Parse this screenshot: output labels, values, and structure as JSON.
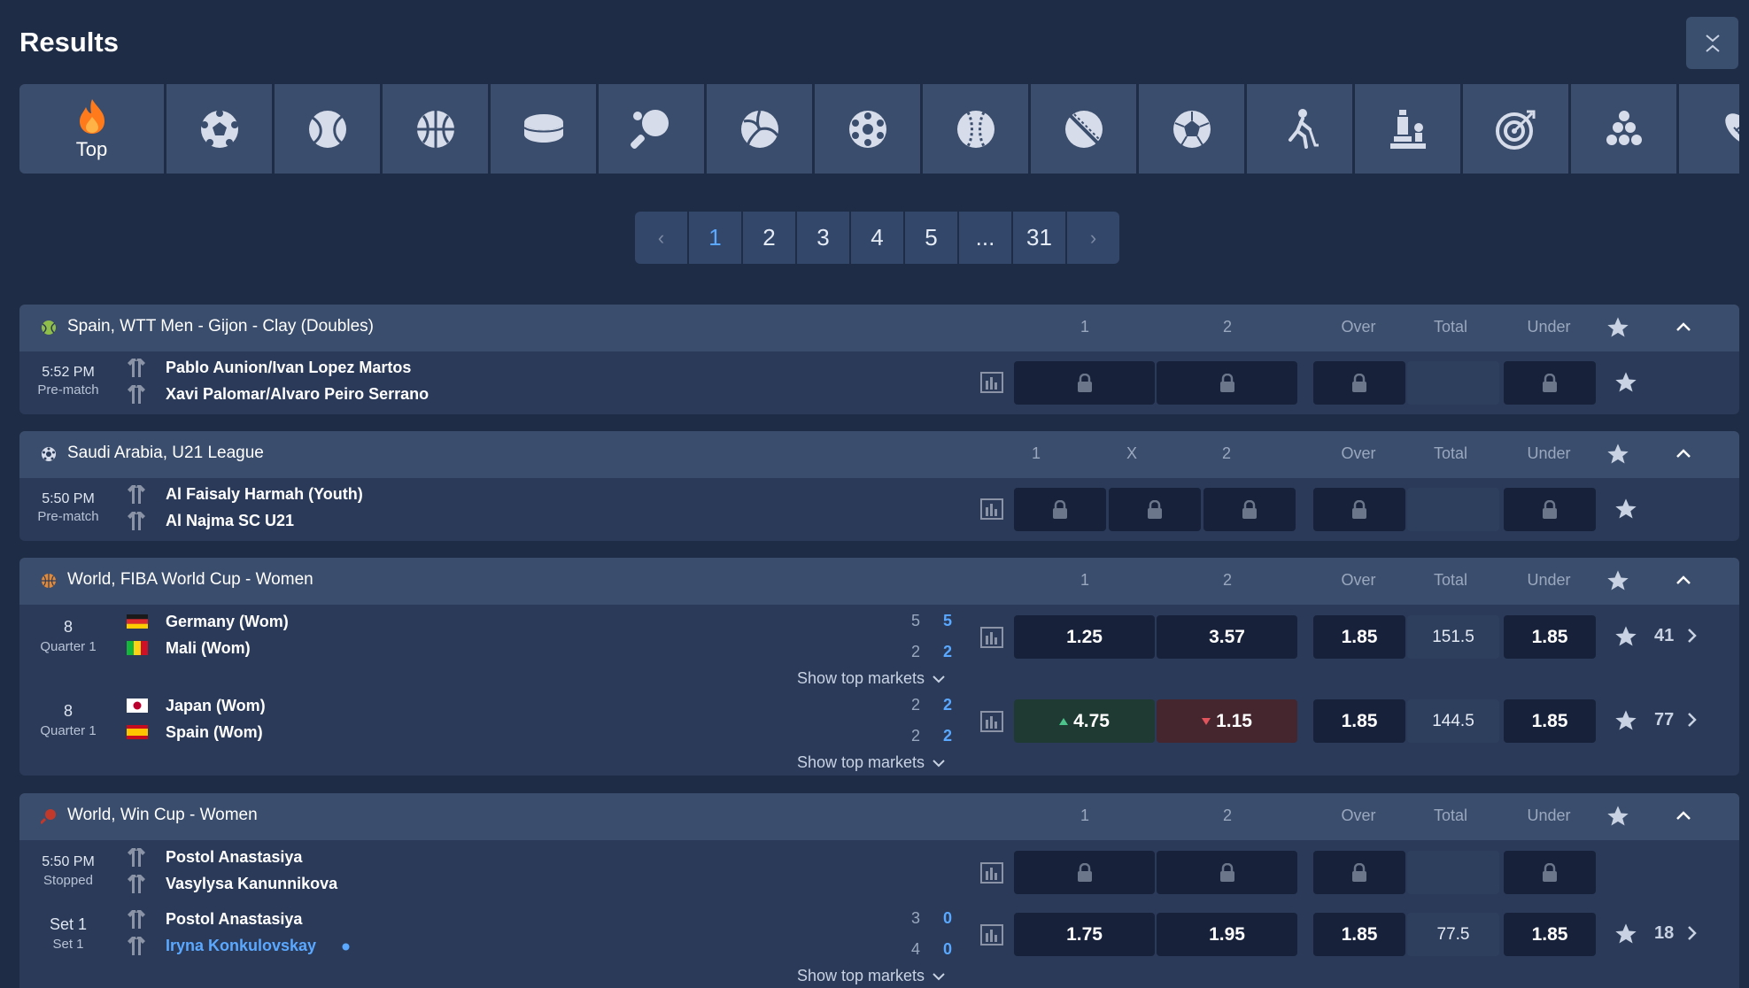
{
  "title": "Results",
  "sports_tabs": {
    "top_label": "Top",
    "icons": [
      "fire-icon",
      "soccer-ball-icon",
      "tennis-ball-icon",
      "basketball-icon",
      "ice-hockey-puck-icon",
      "table-tennis-icon",
      "volleyball-icon",
      "futsal-ball-icon",
      "baseball-icon",
      "cricket-ball-icon",
      "soccer-icon-2",
      "field-hockey-icon",
      "chess-icon",
      "darts-icon",
      "pool-balls-icon",
      "american-football-icon"
    ]
  },
  "pagination": {
    "pages": [
      "1",
      "2",
      "3",
      "4",
      "5",
      "...",
      "31"
    ],
    "active": "1"
  },
  "leagues": [
    {
      "name": "Spain, WTT Men - Gijon - Clay (Doubles)",
      "icon": "tennis-ball-icon",
      "columns": [
        "1",
        "2",
        "Over",
        "Total",
        "Under"
      ],
      "matches": [
        {
          "time": "5:52 PM",
          "status": "Pre-match",
          "team1": "Pablo Aunion/Ivan Lopez Martos",
          "team2": "Xavi Palomar/Alvaro Peiro Serrano",
          "locked": true
        }
      ]
    },
    {
      "name": "Saudi Arabia, U21 League",
      "icon": "soccer-ball-icon",
      "columns": [
        "1",
        "X",
        "2",
        "Over",
        "Total",
        "Under"
      ],
      "matches": [
        {
          "time": "5:50 PM",
          "status": "Pre-match",
          "team1": "Al Faisaly Harmah (Youth)",
          "team2": "Al Najma SC U21",
          "locked": true
        }
      ]
    },
    {
      "name": "World, FIBA World Cup - Women",
      "icon": "basketball-icon",
      "columns": [
        "1",
        "2",
        "Over",
        "Total",
        "Under"
      ],
      "matches": [
        {
          "time": "8",
          "status": "Quarter 1",
          "team1": "Germany (Wom)",
          "team2": "Mali (Wom)",
          "score1a": "5",
          "score1b": "5",
          "score2a": "2",
          "score2b": "2",
          "odd1": "1.25",
          "odd2": "3.57",
          "over": "1.85",
          "total": "151.5",
          "under": "1.85",
          "more": "41"
        },
        {
          "time": "8",
          "status": "Quarter 1",
          "team1": "Japan (Wom)",
          "team2": "Spain (Wom)",
          "score1a": "2",
          "score1b": "2",
          "score2a": "2",
          "score2b": "2",
          "odd1": "4.75",
          "odd2": "1.15",
          "over": "1.85",
          "total": "144.5",
          "under": "1.85",
          "more": "77"
        }
      ],
      "show_top_markets": "Show top markets"
    },
    {
      "name": "World, Win Cup - Women",
      "icon": "table-tennis-icon",
      "columns": [
        "1",
        "2",
        "Over",
        "Total",
        "Under"
      ],
      "matches": [
        {
          "time": "5:50 PM",
          "status": "Stopped",
          "team1": "Postol Anastasiya",
          "team2": "Vasylysa Kanunnikova",
          "locked": true
        },
        {
          "time": "Set 1",
          "status": "Set 1",
          "team1": "Postol Anastasiya",
          "team2": "Iryna Konkulovskay",
          "score1a": "3",
          "score1b": "0",
          "score2a": "4",
          "score2b": "0",
          "odd1": "1.75",
          "odd2": "1.95",
          "over": "1.85",
          "total": "77.5",
          "under": "1.85",
          "more": "18"
        }
      ],
      "show_top_markets": "Show top markets"
    }
  ],
  "colors": {
    "background": "#1f2c45",
    "accent": "#5aa8ff",
    "odd_up": "#4cc38a",
    "odd_down": "#e2545b",
    "fire": "#ff7a1a"
  }
}
